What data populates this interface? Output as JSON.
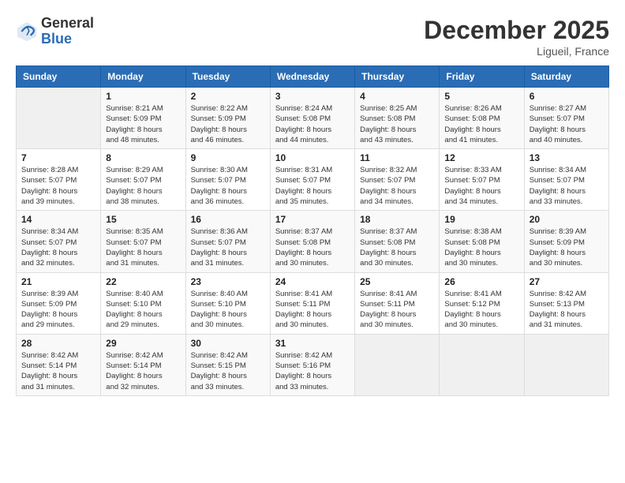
{
  "header": {
    "logo_line1": "General",
    "logo_line2": "Blue",
    "month_year": "December 2025",
    "location": "Ligueil, France"
  },
  "days_of_week": [
    "Sunday",
    "Monday",
    "Tuesday",
    "Wednesday",
    "Thursday",
    "Friday",
    "Saturday"
  ],
  "weeks": [
    [
      {
        "day": "",
        "info": ""
      },
      {
        "day": "1",
        "info": "Sunrise: 8:21 AM\nSunset: 5:09 PM\nDaylight: 8 hours\nand 48 minutes."
      },
      {
        "day": "2",
        "info": "Sunrise: 8:22 AM\nSunset: 5:09 PM\nDaylight: 8 hours\nand 46 minutes."
      },
      {
        "day": "3",
        "info": "Sunrise: 8:24 AM\nSunset: 5:08 PM\nDaylight: 8 hours\nand 44 minutes."
      },
      {
        "day": "4",
        "info": "Sunrise: 8:25 AM\nSunset: 5:08 PM\nDaylight: 8 hours\nand 43 minutes."
      },
      {
        "day": "5",
        "info": "Sunrise: 8:26 AM\nSunset: 5:08 PM\nDaylight: 8 hours\nand 41 minutes."
      },
      {
        "day": "6",
        "info": "Sunrise: 8:27 AM\nSunset: 5:07 PM\nDaylight: 8 hours\nand 40 minutes."
      }
    ],
    [
      {
        "day": "7",
        "info": "Sunrise: 8:28 AM\nSunset: 5:07 PM\nDaylight: 8 hours\nand 39 minutes."
      },
      {
        "day": "8",
        "info": "Sunrise: 8:29 AM\nSunset: 5:07 PM\nDaylight: 8 hours\nand 38 minutes."
      },
      {
        "day": "9",
        "info": "Sunrise: 8:30 AM\nSunset: 5:07 PM\nDaylight: 8 hours\nand 36 minutes."
      },
      {
        "day": "10",
        "info": "Sunrise: 8:31 AM\nSunset: 5:07 PM\nDaylight: 8 hours\nand 35 minutes."
      },
      {
        "day": "11",
        "info": "Sunrise: 8:32 AM\nSunset: 5:07 PM\nDaylight: 8 hours\nand 34 minutes."
      },
      {
        "day": "12",
        "info": "Sunrise: 8:33 AM\nSunset: 5:07 PM\nDaylight: 8 hours\nand 34 minutes."
      },
      {
        "day": "13",
        "info": "Sunrise: 8:34 AM\nSunset: 5:07 PM\nDaylight: 8 hours\nand 33 minutes."
      }
    ],
    [
      {
        "day": "14",
        "info": "Sunrise: 8:34 AM\nSunset: 5:07 PM\nDaylight: 8 hours\nand 32 minutes."
      },
      {
        "day": "15",
        "info": "Sunrise: 8:35 AM\nSunset: 5:07 PM\nDaylight: 8 hours\nand 31 minutes."
      },
      {
        "day": "16",
        "info": "Sunrise: 8:36 AM\nSunset: 5:07 PM\nDaylight: 8 hours\nand 31 minutes."
      },
      {
        "day": "17",
        "info": "Sunrise: 8:37 AM\nSunset: 5:08 PM\nDaylight: 8 hours\nand 30 minutes."
      },
      {
        "day": "18",
        "info": "Sunrise: 8:37 AM\nSunset: 5:08 PM\nDaylight: 8 hours\nand 30 minutes."
      },
      {
        "day": "19",
        "info": "Sunrise: 8:38 AM\nSunset: 5:08 PM\nDaylight: 8 hours\nand 30 minutes."
      },
      {
        "day": "20",
        "info": "Sunrise: 8:39 AM\nSunset: 5:09 PM\nDaylight: 8 hours\nand 30 minutes."
      }
    ],
    [
      {
        "day": "21",
        "info": "Sunrise: 8:39 AM\nSunset: 5:09 PM\nDaylight: 8 hours\nand 29 minutes."
      },
      {
        "day": "22",
        "info": "Sunrise: 8:40 AM\nSunset: 5:10 PM\nDaylight: 8 hours\nand 29 minutes."
      },
      {
        "day": "23",
        "info": "Sunrise: 8:40 AM\nSunset: 5:10 PM\nDaylight: 8 hours\nand 30 minutes."
      },
      {
        "day": "24",
        "info": "Sunrise: 8:41 AM\nSunset: 5:11 PM\nDaylight: 8 hours\nand 30 minutes."
      },
      {
        "day": "25",
        "info": "Sunrise: 8:41 AM\nSunset: 5:11 PM\nDaylight: 8 hours\nand 30 minutes."
      },
      {
        "day": "26",
        "info": "Sunrise: 8:41 AM\nSunset: 5:12 PM\nDaylight: 8 hours\nand 30 minutes."
      },
      {
        "day": "27",
        "info": "Sunrise: 8:42 AM\nSunset: 5:13 PM\nDaylight: 8 hours\nand 31 minutes."
      }
    ],
    [
      {
        "day": "28",
        "info": "Sunrise: 8:42 AM\nSunset: 5:14 PM\nDaylight: 8 hours\nand 31 minutes."
      },
      {
        "day": "29",
        "info": "Sunrise: 8:42 AM\nSunset: 5:14 PM\nDaylight: 8 hours\nand 32 minutes."
      },
      {
        "day": "30",
        "info": "Sunrise: 8:42 AM\nSunset: 5:15 PM\nDaylight: 8 hours\nand 33 minutes."
      },
      {
        "day": "31",
        "info": "Sunrise: 8:42 AM\nSunset: 5:16 PM\nDaylight: 8 hours\nand 33 minutes."
      },
      {
        "day": "",
        "info": ""
      },
      {
        "day": "",
        "info": ""
      },
      {
        "day": "",
        "info": ""
      }
    ]
  ]
}
